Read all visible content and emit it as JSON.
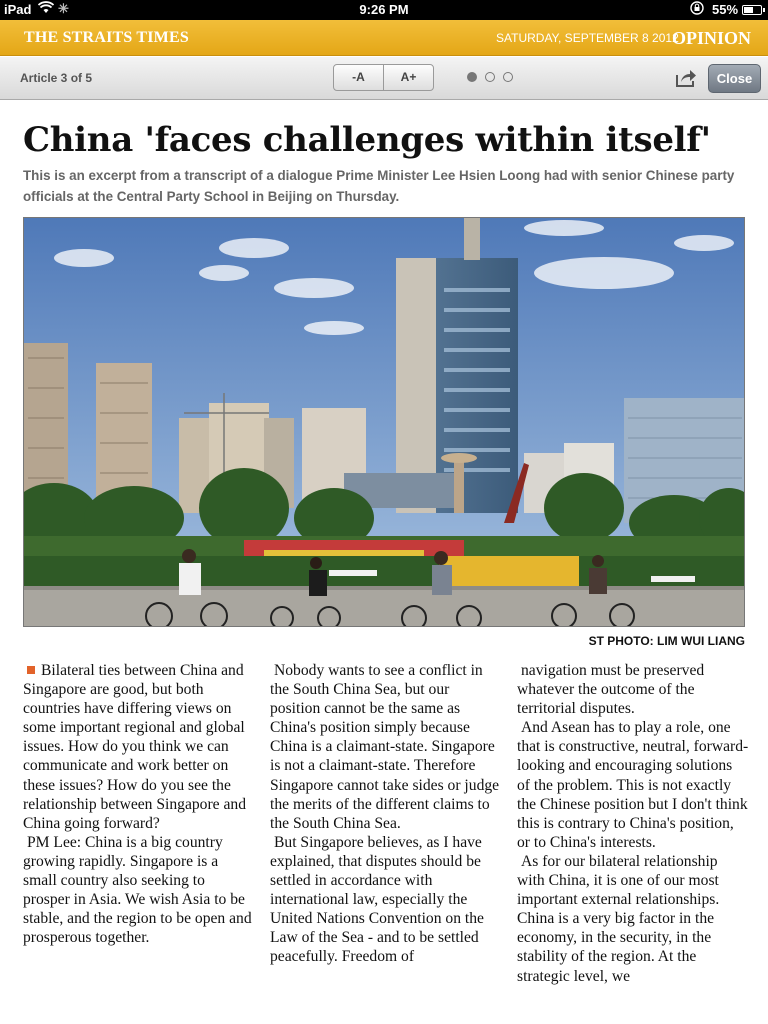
{
  "status_bar": {
    "device": "iPad",
    "time": "9:26 PM",
    "battery": "55%",
    "battery_level": 0.55
  },
  "masthead": {
    "paper": "THE STRAITS TIMES",
    "date": "SATURDAY, SEPTEMBER 8 2012",
    "section": "OPINION"
  },
  "toolbar": {
    "article_counter": "Article 3 of 5",
    "font_smaller": "-A",
    "font_larger": "A+",
    "page_dots": 3,
    "active_dot": 1,
    "close": "Close"
  },
  "article": {
    "headline": "China 'faces challenges within itself'",
    "standfirst": "This is an excerpt from a transcript of a dialogue Prime Minister Lee Hsien Loong had with senior Chinese party officials at the Central Party School in Beijing on Thursday.",
    "photo_credit": "ST PHOTO: LIM WUI LIANG",
    "col1": [
      "Bilateral ties between China and Singapore are good, but both countries have differing views on some important regional and global issues. How do you think we can communicate and work better on these issues? How do you see the relationship between Singapore and China going forward?",
      "PM Lee: China is a big country growing rapidly. Singapore is a small country also seeking to prosper in Asia. We wish Asia to be stable, and the region to be open and prosperous together."
    ],
    "col2": [
      "Nobody wants to see a conflict in the South China Sea, but our position cannot be the same as China's position simply because China is a claimant-state. Singapore is not a claimant-state. Therefore Singapore cannot take sides or judge the merits of the different claims to the South China Sea.",
      "But Singapore believes, as I have explained, that disputes should be settled in accordance with international law, especially the United Nations Convention on the Law of the Sea - and to be settled peacefully. Freedom of"
    ],
    "col3": [
      "navigation must be preserved whatever the outcome of the territorial disputes.",
      "And Asean has to play a role, one that is constructive, neutral, forward-looking and encouraging solutions of the problem. This is not exactly the Chinese position but I don't think this is contrary to China's position, or to China's interests.",
      "As for our bilateral relationship with China, it is one of our most important external relationships. China is a very big factor in the economy, in the security, in the stability of the region. At the strategic level, we"
    ]
  },
  "colors": {
    "masthead": "#e9ae23",
    "bullet": "#e2632a"
  }
}
